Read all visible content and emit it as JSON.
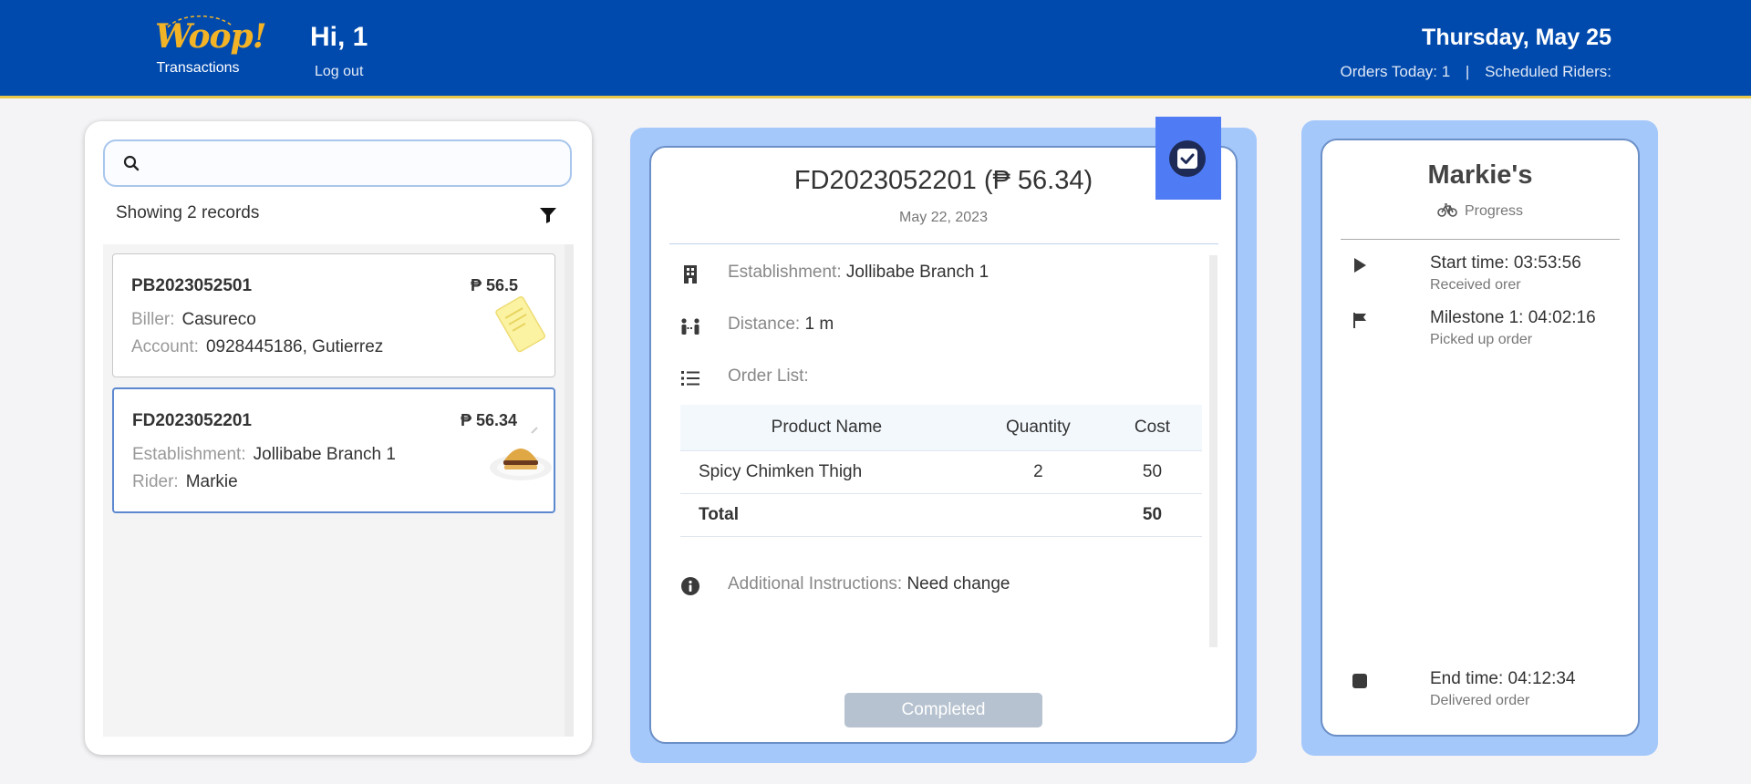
{
  "header": {
    "logo_text": "Woop!",
    "logo_caption": "Transactions",
    "greeting": "Hi, 1",
    "logout": "Log out",
    "date": "Thursday, May 25",
    "orders_today": "Orders Today: 1",
    "separator": "|",
    "scheduled_riders": "Scheduled Riders:",
    "colors": {
      "bar": "#004aad",
      "accent": "#f3b326"
    }
  },
  "sidebar": {
    "search_placeholder": "",
    "records_label": "Showing 2 records",
    "transactions": [
      {
        "id": "PB2023052501",
        "amount": "₱ 56.5",
        "row1_label": "Biller:",
        "row1_value": "Casureco",
        "row2_label": "Account:",
        "row2_value": "0928445186, Gutierrez",
        "icon": "bill-receipt-illustration"
      },
      {
        "id": "FD2023052201",
        "amount": "₱ 56.34",
        "row1_label": "Establishment:",
        "row1_value": "Jollibabe Branch 1",
        "row2_label": "Rider:",
        "row2_value": "Markie",
        "icon": "burger-plate-illustration",
        "selected": true
      }
    ]
  },
  "detail": {
    "title": "FD2023052201 (₱ 56.34)",
    "date": "May 22, 2023",
    "establishment_label": "Establishment:",
    "establishment_value": "Jollibabe Branch 1",
    "distance_label": "Distance:",
    "distance_value": "1 m",
    "order_list_label": "Order List:",
    "table": {
      "headers": [
        "Product Name",
        "Quantity",
        "Cost"
      ],
      "rows": [
        {
          "name": "Spicy Chimken Thigh",
          "qty": "2",
          "cost": "50"
        }
      ],
      "total_label": "Total",
      "total_value": "50"
    },
    "instructions_label": "Additional Instructions:",
    "instructions_value": "Need change",
    "status_button": "Completed"
  },
  "progress": {
    "rider": "Markie's",
    "label": "Progress",
    "timeline": [
      {
        "title": "Start time: 03:53:56",
        "subtitle": "Received orer",
        "icon": "play-icon"
      },
      {
        "title": "Milestone 1: 04:02:16",
        "subtitle": "Picked up order",
        "icon": "flag-icon"
      },
      {
        "title": "End time: 04:12:34",
        "subtitle": "Delivered order",
        "icon": "stop-icon"
      }
    ]
  }
}
